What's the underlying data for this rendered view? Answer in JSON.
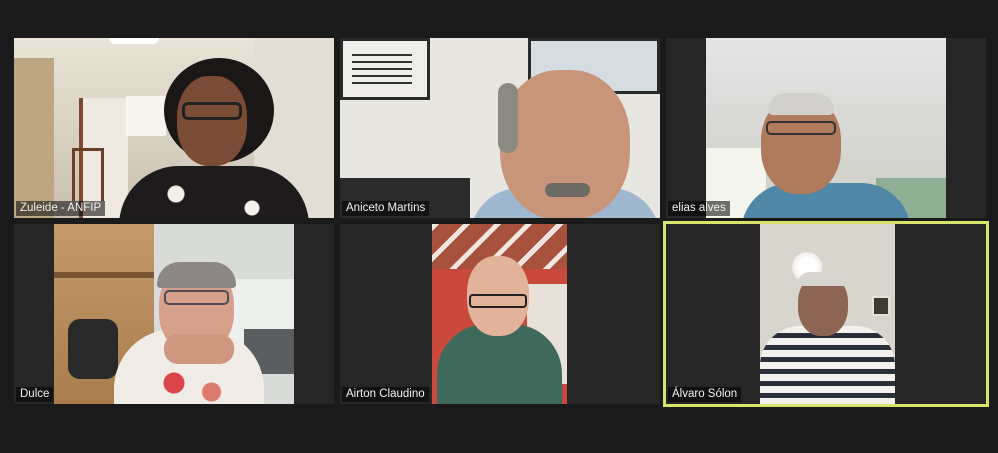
{
  "meeting": {
    "active_speaker_color": "#d7e66a",
    "participants": [
      {
        "name": "Zuleide - ANFIP"
      },
      {
        "name": "Aniceto Martins"
      },
      {
        "name": "elias alves"
      },
      {
        "name": "Dulce"
      },
      {
        "name": "Airton Claudino"
      },
      {
        "name": "Álvaro Sólon"
      }
    ]
  }
}
